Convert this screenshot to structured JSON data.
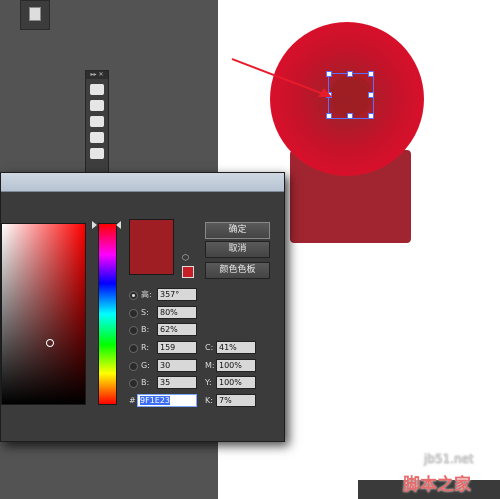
{
  "dialog": {
    "buttons": {
      "ok": "确定",
      "cancel": "取消",
      "swatches": "颜色色板"
    },
    "current_color": "#9f1e23",
    "fields": {
      "h": {
        "label": "高:",
        "value": "357°"
      },
      "s": {
        "label": "S:",
        "value": "80%"
      },
      "b": {
        "label": "B:",
        "value": "62%"
      },
      "r": {
        "label": "R:",
        "value": "159"
      },
      "g": {
        "label": "G:",
        "value": "30"
      },
      "blue": {
        "label": "B:",
        "value": "35"
      },
      "c": {
        "label": "C:",
        "value": "41%"
      },
      "m": {
        "label": "M:",
        "value": "100%"
      },
      "y": {
        "label": "Y:",
        "value": "100%"
      },
      "k": {
        "label": "K:",
        "value": "7%"
      },
      "hex": {
        "label": "#",
        "value": "9F1E23"
      }
    }
  },
  "watermark": {
    "site": "jb51.net",
    "name": "脚本之家"
  },
  "colors": {
    "selection": "#5b6fff",
    "shape_fill": "#9f1e23",
    "circle": "#d8102a"
  },
  "icons": [
    "panel-icon",
    "selection-tool-icon",
    "pen-tool-icon",
    "type-tool-icon",
    "paint-bucket-icon",
    "gamut-warning-icon",
    "arrow-pointer"
  ]
}
